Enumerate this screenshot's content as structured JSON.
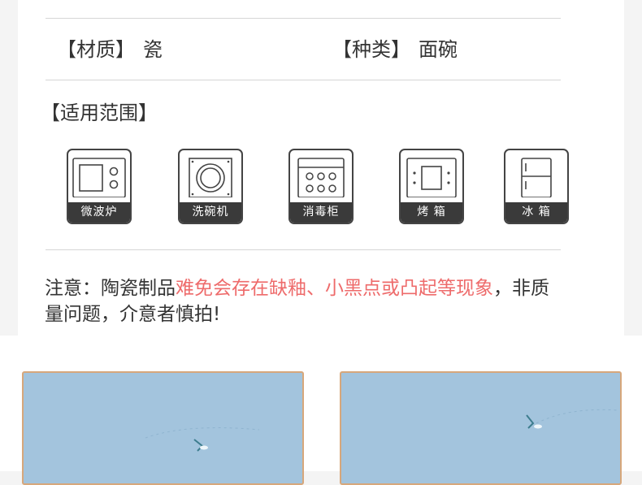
{
  "specs": {
    "material_label": "【材质】",
    "material_value": "瓷",
    "type_label": "【种类】",
    "type_value": "面碗"
  },
  "applicability": {
    "label": "【适用范围】",
    "items": [
      {
        "label": "微波炉",
        "icon": "microwave-icon"
      },
      {
        "label": "洗碗机",
        "icon": "dishwasher-icon"
      },
      {
        "label": "消毒柜",
        "icon": "sterilizer-cabinet-icon"
      },
      {
        "label": "烤 箱",
        "icon": "oven-icon"
      },
      {
        "label": "冰 箱",
        "icon": "refrigerator-icon"
      }
    ]
  },
  "notice": {
    "prefix": "注意：陶瓷制品",
    "highlight": "难免会存在缺釉、小黑点或凸起等现象",
    "suffix": "，非质量问题，介意者慎拍!"
  },
  "colors": {
    "highlight": "#ee6b6b",
    "icon_caption_bg": "#3a3a3a",
    "photo_border": "#d7a77b",
    "photo_bg": "#a3c4dd"
  }
}
